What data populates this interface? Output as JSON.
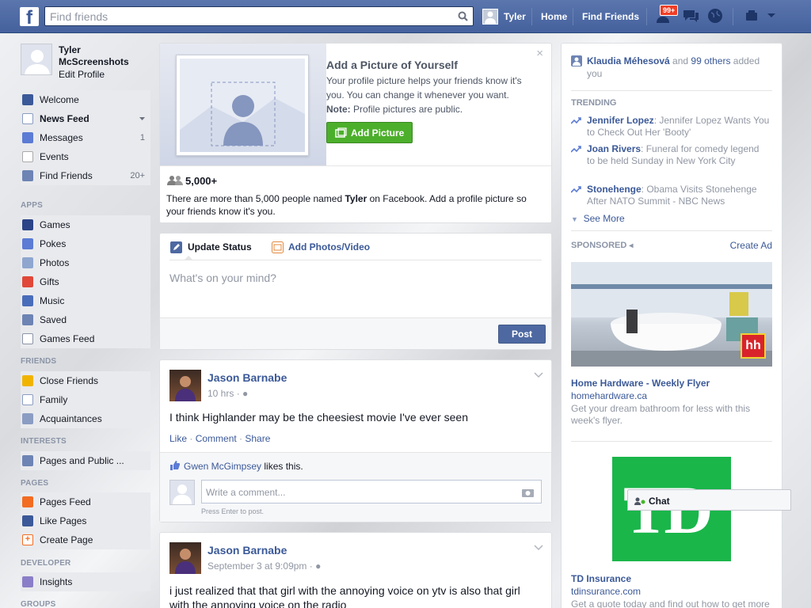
{
  "topbar": {
    "logo": "f",
    "search_placeholder": "Find friends",
    "user_name": "Tyler",
    "home": "Home",
    "find_friends": "Find Friends",
    "notif_count": "99+"
  },
  "profile": {
    "name": "Tyler McScreenshots",
    "edit": "Edit Profile"
  },
  "nav": {
    "favorites": [
      {
        "label": "Welcome",
        "count": ""
      },
      {
        "label": "News Feed",
        "count": ""
      },
      {
        "label": "Messages",
        "count": "1"
      },
      {
        "label": "Events",
        "count": ""
      },
      {
        "label": "Find Friends",
        "count": "20+"
      }
    ],
    "apps_heading": "APPS",
    "apps": [
      "Games",
      "Pokes",
      "Photos",
      "Gifts",
      "Music",
      "Saved",
      "Games Feed"
    ],
    "friends_heading": "FRIENDS",
    "friends": [
      "Close Friends",
      "Family",
      "Acquaintances"
    ],
    "interests_heading": "INTERESTS",
    "interests": [
      "Pages and Public ..."
    ],
    "pages_heading": "PAGES",
    "pages": [
      "Pages Feed",
      "Like Pages",
      "Create Page"
    ],
    "developer_heading": "DEVELOPER",
    "developer": [
      "Insights"
    ],
    "groups_heading": "GROUPS"
  },
  "profile_prompt": {
    "title": "Add a Picture of Yourself",
    "body": "Your profile picture helps your friends know it's you. You can change it whenever you want.",
    "note_label": "Note:",
    "note_text": " Profile pictures are public.",
    "button": "Add Picture",
    "count": "5,000+",
    "desc_prefix": "There are more than 5,000 people named ",
    "desc_name": "Tyler",
    "desc_suffix": " on Facebook. Add a profile picture so your friends know it's you.",
    "close": "×"
  },
  "composer": {
    "tab_status": "Update Status",
    "tab_photos": "Add Photos/Video",
    "placeholder": "What's on your mind?",
    "post": "Post"
  },
  "posts": [
    {
      "author": "Jason Barnabe",
      "time": "10 hrs",
      "text": "I think Highlander may be the cheesiest movie I've ever seen",
      "like": "Like",
      "comment": "Comment",
      "share": "Share",
      "liker": "Gwen McGimpsey",
      "likes_this": " likes this.",
      "comment_placeholder": "Write a comment...",
      "press_enter": "Press Enter to post."
    },
    {
      "author": "Jason Barnabe",
      "time": "September 3 at 9:09pm",
      "text": "i just realized that that girl with the annoying voice on ytv is also that girl with the annoying voice on the radio"
    }
  ],
  "right": {
    "added_name": "Klaudia Méhesová",
    "added_and": " and ",
    "added_others": "99 others",
    "added_suffix": " added you",
    "trending_heading": "TRENDING",
    "trending": [
      {
        "topic": "Jennifer Lopez",
        "text": ": Jennifer Lopez Wants You to Check Out Her 'Booty'"
      },
      {
        "topic": "Joan Rivers",
        "text": ": Funeral for comedy legend to be held Sunday in New York City"
      },
      {
        "topic": "Stonehenge",
        "text": ": Obama Visits Stonehenge After NATO Summit - NBC News"
      }
    ],
    "see_more": "See More",
    "sponsored_heading": "SPONSORED",
    "create_ad": "Create Ad",
    "ads": [
      {
        "title": "Home Hardware - Weekly Flyer",
        "url": "homehardware.ca",
        "desc": "Get your dream bathroom for less with this week's flyer.",
        "logo_text": "hh"
      },
      {
        "title": "TD Insurance",
        "url": "tdinsurance.com",
        "desc": "Get a quote today and find out how to get more",
        "logo_text": "TD"
      }
    ]
  },
  "chat": {
    "label": "Chat"
  },
  "colors": {
    "brand": "#3b5998",
    "topbar": "#4c67a1",
    "green": "#4caf2b",
    "td_green": "#1ab64a",
    "notif": "#f03d25"
  }
}
